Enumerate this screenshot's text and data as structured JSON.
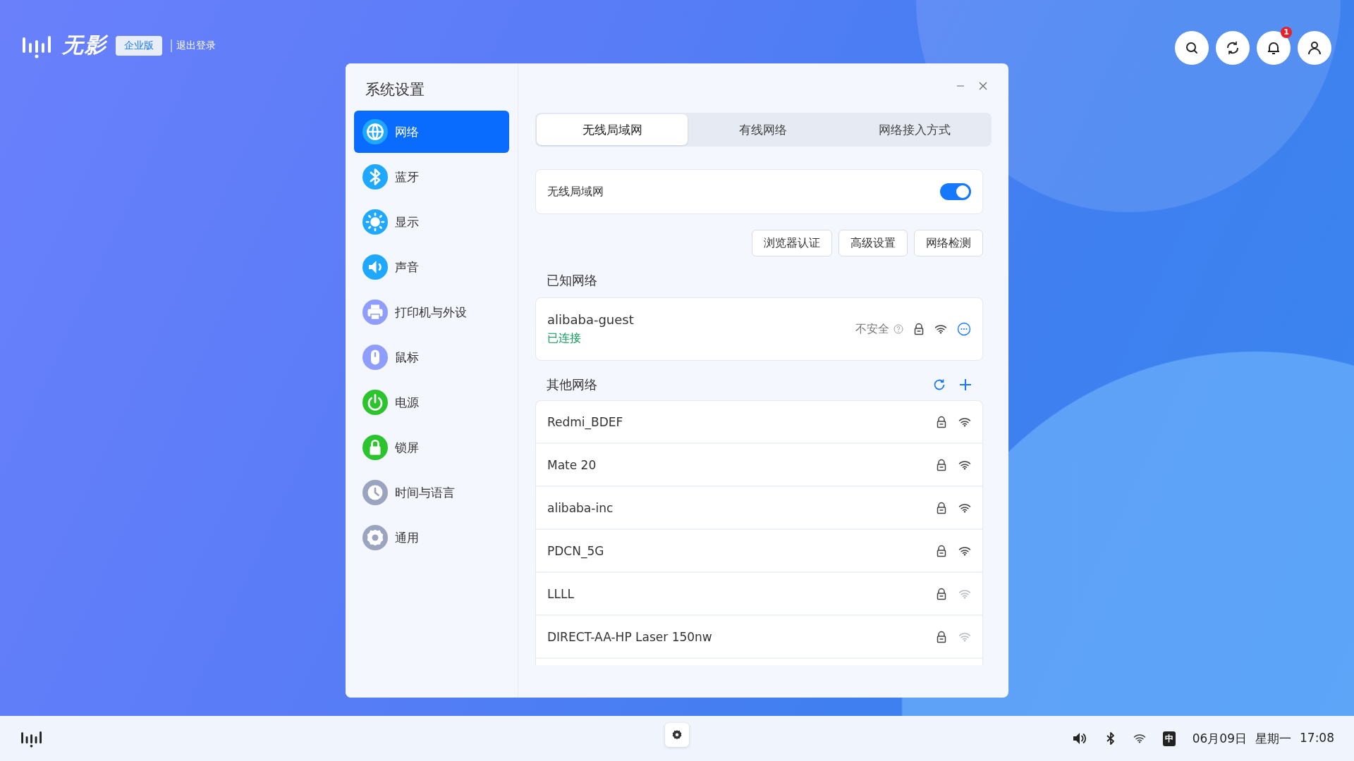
{
  "app_bar": {
    "logo_text": "无影",
    "edition_badge": "企业版",
    "logout_link": "退出登录",
    "notification_count": "1"
  },
  "window": {
    "title": "系统设置"
  },
  "sidebar": {
    "items": [
      {
        "label": "网络",
        "selected": true,
        "color": "#1fa8ff"
      },
      {
        "label": "蓝牙",
        "selected": false,
        "color": "#1fa8ff"
      },
      {
        "label": "显示",
        "selected": false,
        "color": "#1fa8ff"
      },
      {
        "label": "声音",
        "selected": false,
        "color": "#1fa8ff"
      },
      {
        "label": "打印机与外设",
        "selected": false,
        "color": "#8f9dff"
      },
      {
        "label": "鼠标",
        "selected": false,
        "color": "#8f9dff"
      },
      {
        "label": "电源",
        "selected": false,
        "color": "#2cc42c"
      },
      {
        "label": "锁屏",
        "selected": false,
        "color": "#2cc42c"
      },
      {
        "label": "时间与语言",
        "selected": false,
        "color": "#9aa4c0"
      },
      {
        "label": "通用",
        "selected": false,
        "color": "#9aa4c0"
      }
    ]
  },
  "tabs": [
    {
      "label": "无线局域网",
      "selected": true
    },
    {
      "label": "有线网络",
      "selected": false
    },
    {
      "label": "网络接入方式",
      "selected": false
    }
  ],
  "wifi_toggle": {
    "label": "无线局域网",
    "on": true
  },
  "actions": [
    "浏览器认证",
    "高级设置",
    "网络检测"
  ],
  "known_networks": {
    "heading": "已知网络",
    "items": [
      {
        "name": "alibaba-guest",
        "status": "已连接",
        "security": "不安全"
      }
    ]
  },
  "other_networks": {
    "heading": "其他网络",
    "items": [
      {
        "name": "Redmi_BDEF",
        "weak_signal": false
      },
      {
        "name": "Mate 20",
        "weak_signal": false
      },
      {
        "name": "alibaba-inc",
        "weak_signal": false
      },
      {
        "name": "PDCN_5G",
        "weak_signal": false
      },
      {
        "name": "LLLL",
        "weak_signal": true
      },
      {
        "name": "DIRECT-AA-HP Laser 150nw",
        "weak_signal": true
      }
    ]
  },
  "taskbar": {
    "input_method": "中",
    "date": "06月09日",
    "weekday": "星期一",
    "time": "17:08"
  }
}
